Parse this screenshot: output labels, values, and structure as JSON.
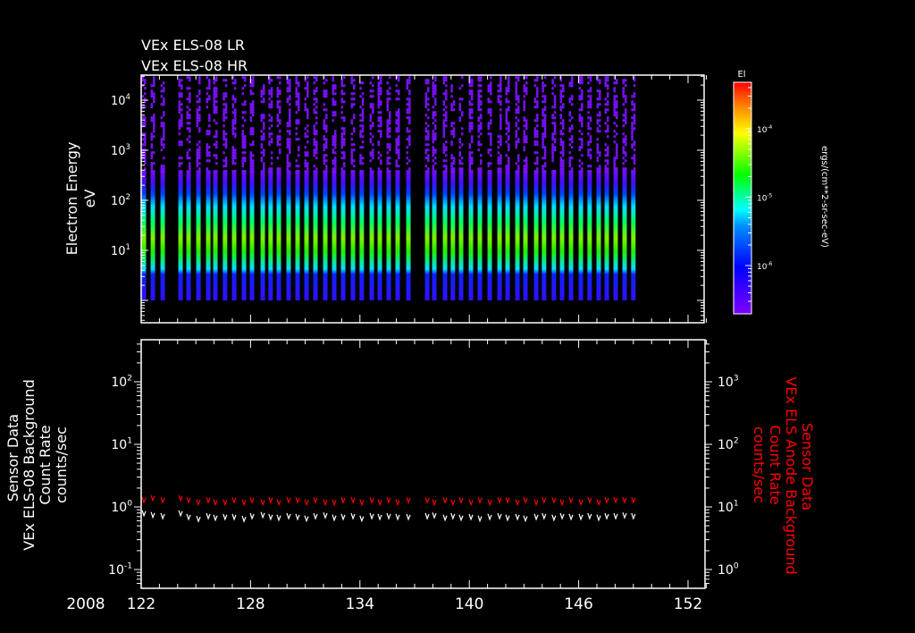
{
  "titles": {
    "line1": "VEx ELS-08 LR",
    "line2": "VEx ELS-08 HR"
  },
  "colors": {
    "background": "#000000",
    "axis": "#ffffff",
    "red_series": "#ff0000",
    "white_series": "#ffffff"
  },
  "chart_data": [
    {
      "type": "heatmap",
      "title": "VEx ELS-08 LR / VEx ELS-08 HR",
      "xlabel": "",
      "ylabel_line1": "Electron Energy",
      "ylabel_line2": "eV",
      "xlim": [
        122,
        153
      ],
      "ylim": [
        0.35,
        30000
      ],
      "yscale": "log",
      "yticks": [
        {
          "base": "10",
          "exp": "4",
          "value": 10000
        },
        {
          "base": "10",
          "exp": "3",
          "value": 1000
        },
        {
          "base": "10",
          "exp": "2",
          "value": 100
        },
        {
          "base": "10",
          "exp": "1",
          "value": 10
        }
      ],
      "stripe_days": [
        122.15,
        122.64,
        123.18,
        124.16,
        124.6,
        125.14,
        125.68,
        126.07,
        126.6,
        127.1,
        127.64,
        128.08,
        128.67,
        129.1,
        129.55,
        130.09,
        130.58,
        131.07,
        131.56,
        132.1,
        132.59,
        133.08,
        133.62,
        134.1,
        134.65,
        135.09,
        135.58,
        136.07,
        136.66,
        137.69,
        138.08,
        138.67,
        139.1,
        139.55,
        140.09,
        140.58,
        141.12,
        141.66,
        142.1,
        142.64,
        143.08,
        143.67,
        144.1,
        144.64,
        145.09,
        145.58,
        146.12,
        146.6,
        147.1,
        147.54,
        148.03,
        148.52,
        149.0
      ],
      "energy_range_eV": [
        1,
        30000
      ],
      "peak_energy_eV": 20,
      "colorbar": {
        "label": "El",
        "units": "ergs/(cm**2-sr-sec-eV)",
        "ticks": [
          {
            "base": "10",
            "exp": "-4"
          },
          {
            "base": "10",
            "exp": "-5"
          },
          {
            "base": "10",
            "exp": "-6"
          }
        ],
        "range": [
          2e-07,
          0.0005
        ],
        "scale": "log"
      }
    },
    {
      "type": "line",
      "xlim": [
        122,
        153
      ],
      "xticks": [
        "122",
        "128",
        "134",
        "140",
        "146",
        "152"
      ],
      "year_label": "2008",
      "yscale": "log",
      "left_axis": {
        "label_lines": [
          "Sensor Data",
          "VEx ELS-08 Background",
          "Count Rate",
          "counts/sec"
        ],
        "ylim": [
          0.055,
          40
        ],
        "ticks": [
          {
            "base": "10",
            "exp": "2"
          },
          {
            "base": "10",
            "exp": "1"
          },
          {
            "base": "10",
            "exp": "0"
          },
          {
            "base": "10",
            "exp": "-1"
          }
        ]
      },
      "right_axis": {
        "label_lines": [
          "Sensor Data",
          "VEx ELS Anode Background",
          "Count Rate",
          "counts/sec"
        ],
        "ylim": [
          0.55,
          4000
        ],
        "ticks": [
          {
            "base": "10",
            "exp": "3"
          },
          {
            "base": "10",
            "exp": "2"
          },
          {
            "base": "10",
            "exp": "1"
          },
          {
            "base": "10",
            "exp": "0"
          }
        ]
      },
      "series": [
        {
          "name": "VEx ELS-08 Background",
          "axis": "left",
          "color": "#ffffff",
          "values": [
            0.8,
            0.75,
            0.72,
            0.8,
            0.7,
            0.65,
            0.72,
            0.68,
            0.7,
            0.7,
            0.65,
            0.72,
            0.75,
            0.7,
            0.68,
            0.72,
            0.7,
            0.66,
            0.72,
            0.74,
            0.68,
            0.7,
            0.72,
            0.66,
            0.72,
            0.7,
            0.72,
            0.7,
            0.7,
            0.72,
            0.74,
            0.68,
            0.72,
            0.68,
            0.7,
            0.66,
            0.7,
            0.72,
            0.68,
            0.7,
            0.66,
            0.7,
            0.72,
            0.68,
            0.72,
            0.7,
            0.7,
            0.72,
            0.68,
            0.72,
            0.72,
            0.74,
            0.72
          ]
        },
        {
          "name": "VEx ELS Anode Background",
          "axis": "right",
          "color": "#ff0000",
          "values": [
            13,
            14,
            13,
            14,
            13,
            12,
            13,
            12,
            12,
            13,
            12,
            13,
            12,
            13,
            12,
            13,
            13,
            12,
            13,
            12,
            12,
            13,
            13,
            12,
            13,
            12,
            13,
            12,
            13,
            13,
            12,
            13,
            12,
            13,
            12,
            13,
            12,
            13,
            13,
            12,
            13,
            12,
            13,
            13,
            12,
            13,
            12,
            13,
            12,
            13,
            13,
            13,
            13
          ]
        }
      ]
    }
  ]
}
